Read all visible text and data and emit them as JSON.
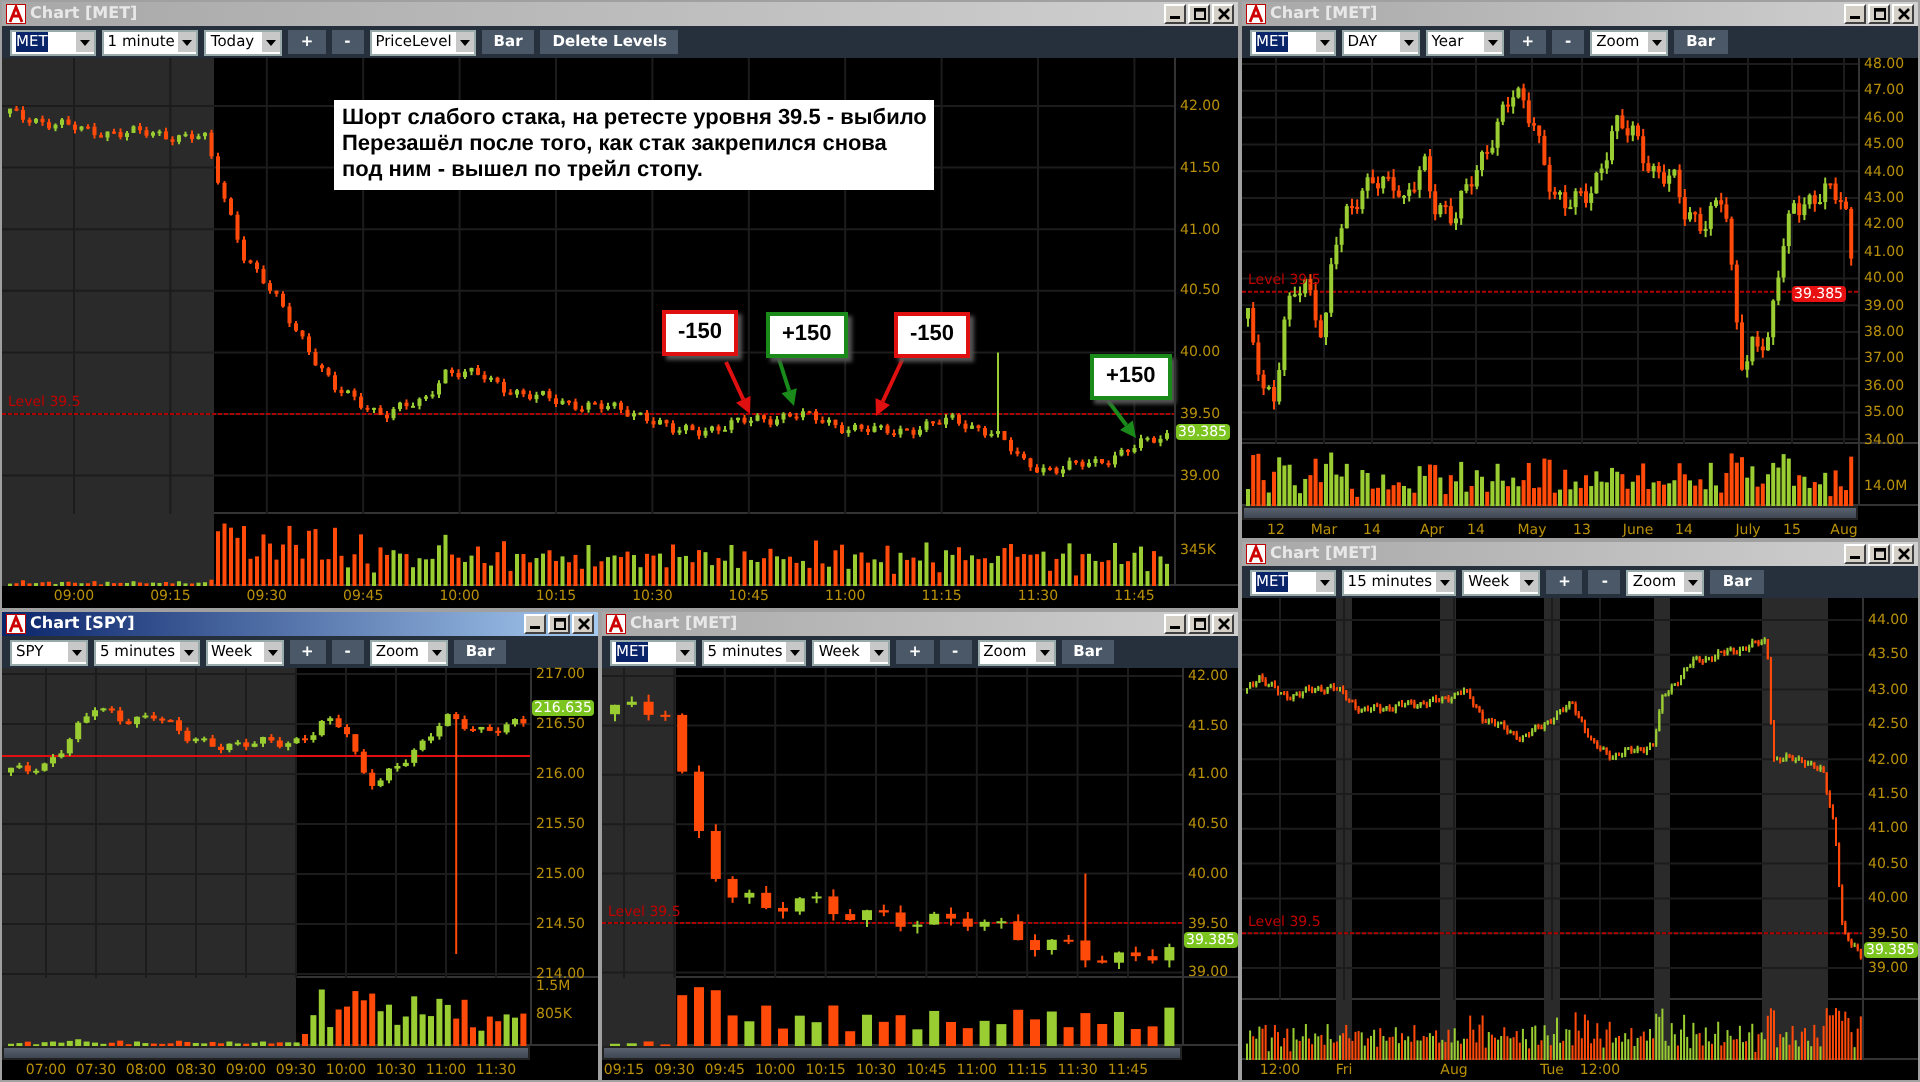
{
  "windows": [
    {
      "title": "Chart [MET]",
      "selected": false,
      "toolbar": [
        {
          "kind": "dropdown",
          "value": "MET",
          "highlighted": true
        },
        {
          "kind": "dropdown",
          "value": "1 minute",
          "highlighted": false
        },
        {
          "kind": "dropdown",
          "value": "Today",
          "highlighted": false
        },
        {
          "kind": "button",
          "label": "+"
        },
        {
          "kind": "button",
          "label": "-"
        },
        {
          "kind": "dropdown",
          "value": "PriceLevel",
          "highlighted": false
        },
        {
          "kind": "button",
          "label": "Bar"
        },
        {
          "kind": "button",
          "label": "Delete Levels"
        }
      ],
      "level_label": "Level 39.5",
      "price_tag": {
        "text": "39.385",
        "color": "#7cc41f"
      },
      "price_ticks": [
        "42.00",
        "41.50",
        "41.00",
        "40.50",
        "40.00",
        "39.50",
        "39.00"
      ],
      "volume_ticks": [
        "345K"
      ],
      "time_labels": [
        "09:00",
        "09:15",
        "09:30",
        "09:45",
        "10:00",
        "10:15",
        "10:30",
        "10:45",
        "11:00",
        "11:15",
        "11:30",
        "11:45"
      ],
      "note": {
        "lines": [
          "Шорт слабого стака, на ретесте уровня 39.5 - выбило",
          "Перезашёл после того, как стак закрепился снова",
          "под ним - вышел по трейл стопу."
        ]
      },
      "trades": [
        {
          "label": "-150",
          "color": "#e01010"
        },
        {
          "label": "+150",
          "color": "#1a8a1a"
        },
        {
          "label": "-150",
          "color": "#e01010"
        },
        {
          "label": "+150",
          "color": "#1a8a1a"
        }
      ]
    },
    {
      "title": "Chart [MET]",
      "selected": false,
      "toolbar": [
        {
          "kind": "dropdown",
          "value": "MET",
          "highlighted": true
        },
        {
          "kind": "dropdown",
          "value": "DAY",
          "highlighted": false
        },
        {
          "kind": "dropdown",
          "value": "Year",
          "highlighted": false
        },
        {
          "kind": "button",
          "label": "+"
        },
        {
          "kind": "button",
          "label": "-"
        },
        {
          "kind": "dropdown",
          "value": "Zoom",
          "highlighted": false
        },
        {
          "kind": "button",
          "label": "Bar"
        }
      ],
      "level_label": "Level 39.5",
      "price_tag": {
        "text": "39.385",
        "color": "#e81010"
      },
      "price_ticks": [
        "48.00",
        "47.00",
        "46.00",
        "45.00",
        "44.00",
        "43.00",
        "42.00",
        "41.00",
        "40.00",
        "39.00",
        "38.00",
        "37.00",
        "36.00",
        "35.00",
        "34.00"
      ],
      "volume_ticks": [
        "14.0M"
      ],
      "time_labels": [
        "12",
        "Mar",
        "14",
        "Apr",
        "14",
        "May",
        "13",
        "June",
        "14",
        "July",
        "15",
        "Aug"
      ]
    },
    {
      "title": "Chart [SPY]",
      "selected": true,
      "toolbar": [
        {
          "kind": "dropdown",
          "value": "SPY",
          "highlighted": false
        },
        {
          "kind": "dropdown",
          "value": "5 minutes",
          "highlighted": false
        },
        {
          "kind": "dropdown",
          "value": "Week",
          "highlighted": false
        },
        {
          "kind": "button",
          "label": "+"
        },
        {
          "kind": "button",
          "label": "-"
        },
        {
          "kind": "dropdown",
          "value": "Zoom",
          "highlighted": false
        },
        {
          "kind": "button",
          "label": "Bar"
        }
      ],
      "price_tag": {
        "text": "216.635",
        "color": "#7cc41f"
      },
      "price_ticks": [
        "217.00",
        "216.50",
        "216.00",
        "215.50",
        "215.00",
        "214.50",
        "214.00"
      ],
      "volume_ticks": [
        "1.5M",
        "805K"
      ],
      "time_labels": [
        "07:00",
        "07:30",
        "08:00",
        "08:30",
        "09:00",
        "09:30",
        "10:00",
        "10:30",
        "11:00",
        "11:30"
      ]
    },
    {
      "title": "Chart [MET]",
      "selected": false,
      "toolbar": [
        {
          "kind": "dropdown",
          "value": "MET",
          "highlighted": true
        },
        {
          "kind": "dropdown",
          "value": "5 minutes",
          "highlighted": false
        },
        {
          "kind": "dropdown",
          "value": "Week",
          "highlighted": false
        },
        {
          "kind": "button",
          "label": "+"
        },
        {
          "kind": "button",
          "label": "-"
        },
        {
          "kind": "dropdown",
          "value": "Zoom",
          "highlighted": false
        },
        {
          "kind": "button",
          "label": "Bar"
        }
      ],
      "level_label": "Level 39.5",
      "price_tag": {
        "text": "39.385",
        "color": "#7cc41f"
      },
      "price_ticks": [
        "42.00",
        "41.50",
        "41.00",
        "40.50",
        "40.00",
        "39.50",
        "39.00"
      ],
      "time_labels": [
        "09:15",
        "09:30",
        "09:45",
        "10:00",
        "10:15",
        "10:30",
        "10:45",
        "11:00",
        "11:15",
        "11:30",
        "11:45"
      ]
    },
    {
      "title": "Chart [MET]",
      "selected": false,
      "toolbar": [
        {
          "kind": "dropdown",
          "value": "MET",
          "highlighted": true
        },
        {
          "kind": "dropdown",
          "value": "15 minutes",
          "highlighted": false
        },
        {
          "kind": "dropdown",
          "value": "Week",
          "highlighted": false
        },
        {
          "kind": "button",
          "label": "+"
        },
        {
          "kind": "button",
          "label": "-"
        },
        {
          "kind": "dropdown",
          "value": "Zoom",
          "highlighted": false
        },
        {
          "kind": "button",
          "label": "Bar"
        }
      ],
      "level_label": "Level 39.5",
      "price_tag": {
        "text": "39.385",
        "color": "#7cc41f"
      },
      "price_ticks": [
        "44.00",
        "43.50",
        "43.00",
        "42.50",
        "42.00",
        "41.50",
        "41.00",
        "40.50",
        "40.00",
        "39.50",
        "39.00"
      ],
      "time_labels": [
        "12:00",
        "Fri",
        "Aug",
        "Tue",
        "12:00"
      ]
    }
  ]
}
